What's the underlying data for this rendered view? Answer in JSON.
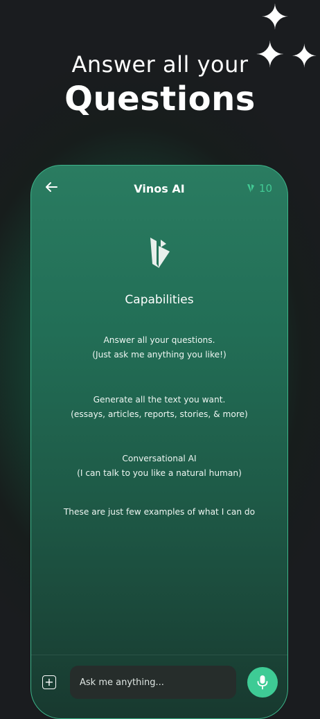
{
  "hero": {
    "line1": "Answer all your",
    "line2": "Questions"
  },
  "decor": {
    "sparkle_icon": "✦"
  },
  "header": {
    "title": "Vinos AI",
    "credits": "10",
    "accent_color": "#42c994"
  },
  "capabilities": {
    "title": "Capabilities",
    "items": [
      {
        "line1": "Answer all your questions.",
        "line2": "(Just ask me anything you like!)"
      },
      {
        "line1": "Generate all the text you want.",
        "line2": "(essays, articles, reports, stories, & more)"
      },
      {
        "line1": "Conversational AI",
        "line2": "(I can talk to you like a natural human)"
      }
    ],
    "footer": "These are just few examples of what I can do"
  },
  "composer": {
    "placeholder": "Ask me anything...",
    "add_icon": "+"
  },
  "colors": {
    "mic_button": "#3ecb95",
    "input_bg": "#262d2b",
    "phone_border": "#3db48a"
  }
}
